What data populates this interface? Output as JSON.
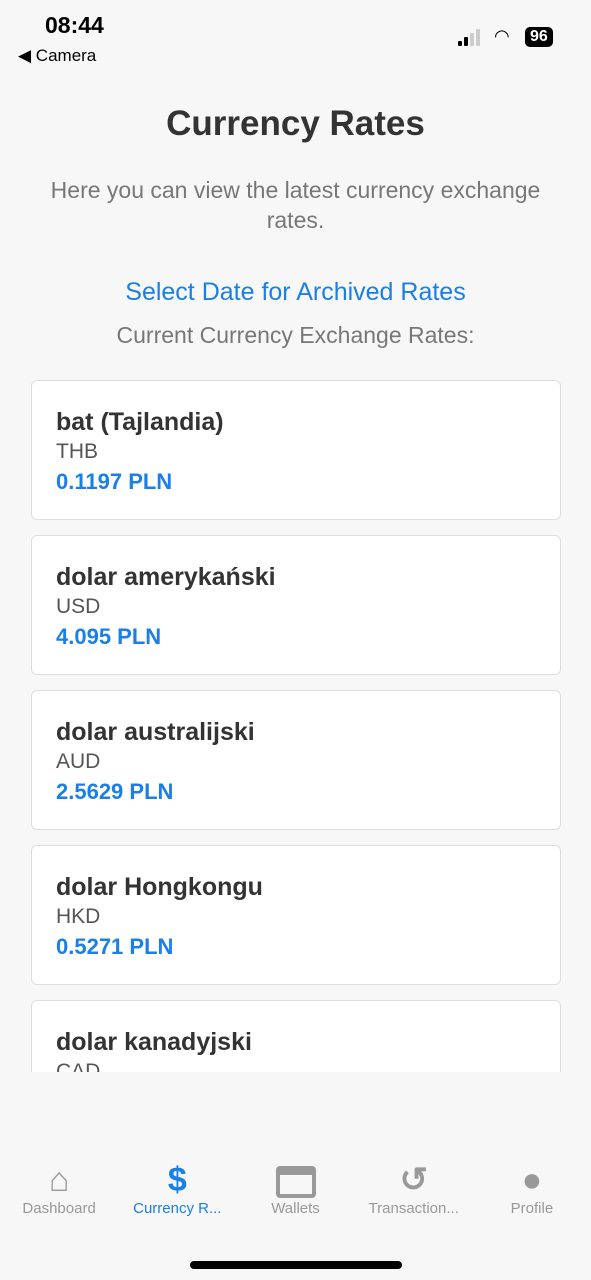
{
  "status": {
    "time": "08:44",
    "back": "Camera",
    "battery": "96"
  },
  "page": {
    "title": "Currency Rates",
    "description": "Here you can view the latest currency exchange rates.",
    "archive_link": "Select Date for Archived Rates",
    "current_label": "Current Currency Exchange Rates:"
  },
  "rates": [
    {
      "name": "bat (Tajlandia)",
      "code": "THB",
      "rate": "0.1197 PLN"
    },
    {
      "name": "dolar amerykański",
      "code": "USD",
      "rate": "4.095 PLN"
    },
    {
      "name": "dolar australijski",
      "code": "AUD",
      "rate": "2.5629 PLN"
    },
    {
      "name": "dolar Hongkongu",
      "code": "HKD",
      "rate": "0.5271 PLN"
    },
    {
      "name": "dolar kanadyjski",
      "code": "CAD",
      "rate": ""
    }
  ],
  "tabs": [
    {
      "label": "Dashboard",
      "icon": "home-icon",
      "active": false
    },
    {
      "label": "Currency R...",
      "icon": "dollar-icon",
      "active": true
    },
    {
      "label": "Wallets",
      "icon": "credit-card-icon",
      "active": false
    },
    {
      "label": "Transaction...",
      "icon": "history-icon",
      "active": false
    },
    {
      "label": "Profile",
      "icon": "user-icon",
      "active": false
    }
  ],
  "colors": {
    "accent": "#1a7fe6",
    "inactive": "#999999"
  }
}
